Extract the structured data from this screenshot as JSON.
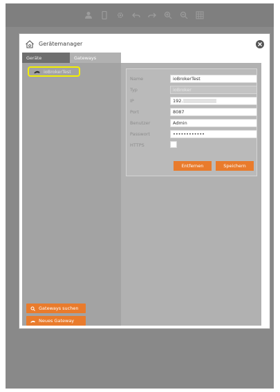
{
  "toolbar": {
    "icons": [
      "user-icon",
      "phone-icon",
      "gear-icon",
      "undo-icon",
      "redo-icon",
      "zoom-in-icon",
      "zoom-out-icon",
      "grid-icon"
    ]
  },
  "dialog": {
    "title": "Gerätemanager",
    "tabs": [
      {
        "label": "Geräte",
        "active": true
      },
      {
        "label": "Gateways",
        "active": false
      }
    ]
  },
  "device_list": {
    "items": [
      {
        "label": "ioBrokerTest",
        "selected": true
      }
    ]
  },
  "left_buttons": {
    "search_gateways": "Gateways suchen",
    "new_gateway": "Neues Gateway"
  },
  "form": {
    "name": {
      "label": "Name",
      "value": "ioBrokerTest"
    },
    "typ": {
      "label": "Typ",
      "value": "ioBroker"
    },
    "ip": {
      "label": "IP",
      "value": "192."
    },
    "port": {
      "label": "Port",
      "value": "8087"
    },
    "benutzer": {
      "label": "Benutzer",
      "value": "Admin"
    },
    "passwort": {
      "label": "Passwort",
      "value": "••••••••••••"
    },
    "https": {
      "label": "HTTPS",
      "checked": false
    }
  },
  "actions": {
    "remove": "Entfernen",
    "save": "Speichern"
  },
  "colors": {
    "accent": "#e97b2c",
    "highlight": "#f4f000",
    "app_background": "#898989"
  }
}
